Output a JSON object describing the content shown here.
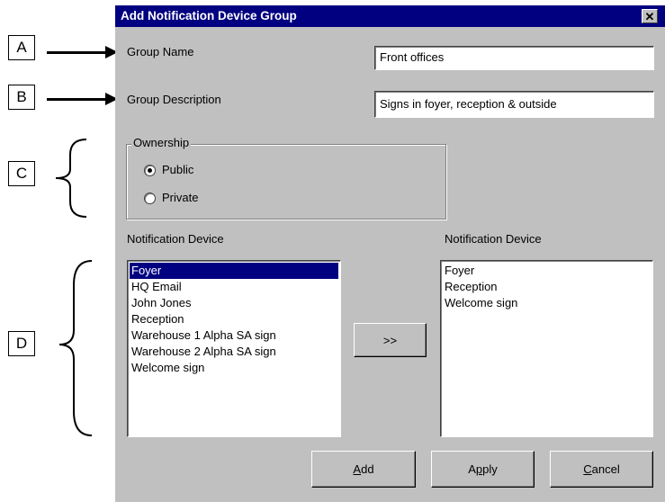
{
  "callouts": [
    "A",
    "B",
    "C",
    "D"
  ],
  "dialog": {
    "title": "Add Notification Device Group",
    "close_glyph": "✕",
    "group_name": {
      "label": "Group Name",
      "value": "Front offices"
    },
    "group_description": {
      "label": "Group Description",
      "value": "Signs in foyer, reception & outside"
    },
    "ownership": {
      "legend": "Ownership",
      "options": [
        {
          "label": "Public",
          "selected": true
        },
        {
          "label": "Private",
          "selected": false
        }
      ]
    },
    "available_devices": {
      "label": "Notification Device",
      "items": [
        "Foyer",
        "HQ Email",
        "John Jones",
        "Reception",
        "Warehouse 1 Alpha SA sign",
        "Warehouse 2 Alpha SA sign",
        "Welcome sign"
      ],
      "selected_index": 0
    },
    "move_button_label": ">>",
    "selected_devices": {
      "label": "Notification Device",
      "items": [
        "Foyer",
        "Reception",
        "Welcome sign"
      ]
    },
    "buttons": {
      "add": {
        "mnemonic": "A",
        "rest": "dd"
      },
      "apply": {
        "pre": "A",
        "mnemonic": "p",
        "rest": "ply"
      },
      "cancel": {
        "mnemonic": "C",
        "rest": "ancel"
      }
    }
  },
  "colors": {
    "titlebar": "#000080",
    "dialog_face": "#c0c0c0",
    "selection": "#000080"
  }
}
